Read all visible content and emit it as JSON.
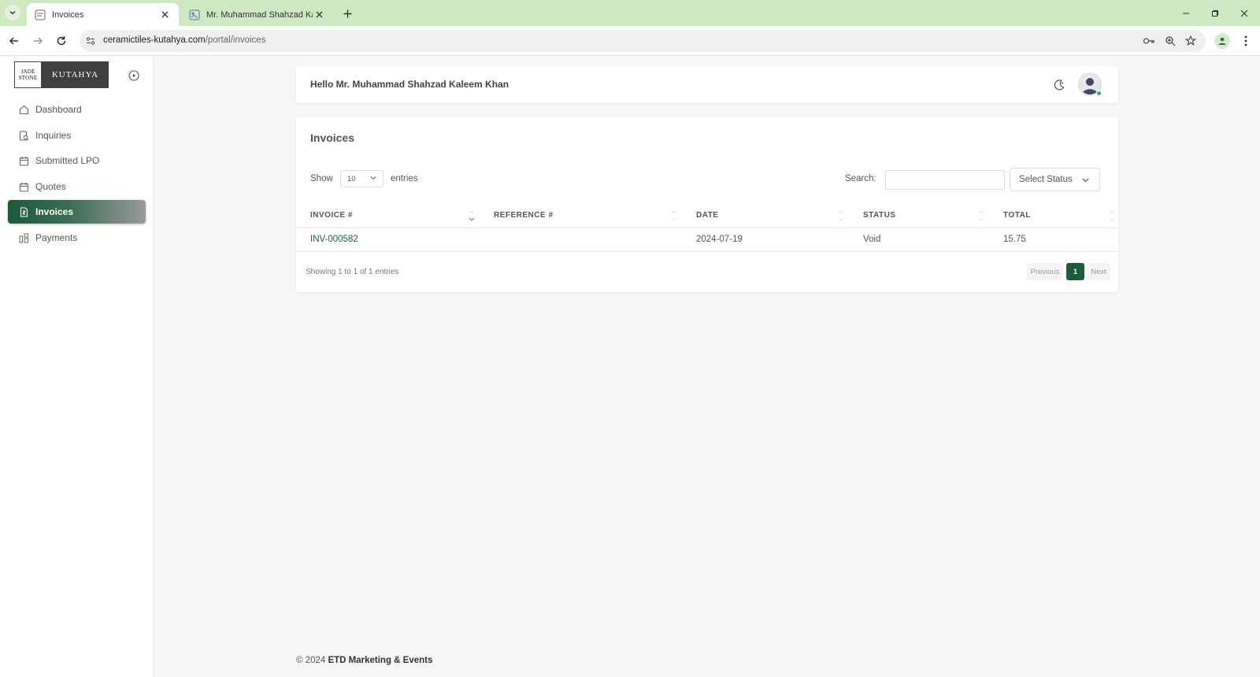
{
  "browser": {
    "tabs": [
      {
        "title": "Invoices",
        "active": true
      },
      {
        "title": "Mr. Muhammad Shahzad Kale",
        "active": false
      }
    ],
    "url_domain": "ceramictiles-kutahya.com",
    "url_path": "/portal/invoices"
  },
  "brand": {
    "logo_left_line1": "JADE",
    "logo_left_line2": "STONE",
    "logo_right": "KUTAHYA"
  },
  "sidebar": {
    "items": [
      {
        "label": "Dashboard",
        "icon": "home-icon",
        "active": false
      },
      {
        "label": "Inquiries",
        "icon": "inquiry-icon",
        "active": false
      },
      {
        "label": "Submitted LPO",
        "icon": "calendar-icon",
        "active": false
      },
      {
        "label": "Quotes",
        "icon": "calendar-icon",
        "active": false
      },
      {
        "label": "Invoices",
        "icon": "invoice-icon",
        "active": true
      },
      {
        "label": "Payments",
        "icon": "payments-icon",
        "active": false
      }
    ]
  },
  "header": {
    "greeting": "Hello Mr. Muhammad Shahzad Kaleem Khan"
  },
  "invoices": {
    "title": "Invoices",
    "show_label": "Show",
    "page_length": "10",
    "entries_label": "entries",
    "search_label": "Search:",
    "search_value": "",
    "status_filter": "Select Status",
    "columns": [
      "INVOICE #",
      "REFERENCE #",
      "DATE",
      "STATUS",
      "TOTAL"
    ],
    "rows": [
      {
        "invoice": "INV-000582",
        "reference": "",
        "date": "2024-07-19",
        "status": "Void",
        "total": "15.75"
      }
    ],
    "info": "Showing 1 to 1 of 1 entries",
    "pagination": {
      "previous": "Previous",
      "current": "1",
      "next": "Next"
    }
  },
  "footer": {
    "copyright": "© 2024",
    "company": "ETD Marketing & Events"
  },
  "colors": {
    "accent": "#1d5b3b",
    "tabbar": "#cfe8c4",
    "online": "#29b765"
  }
}
